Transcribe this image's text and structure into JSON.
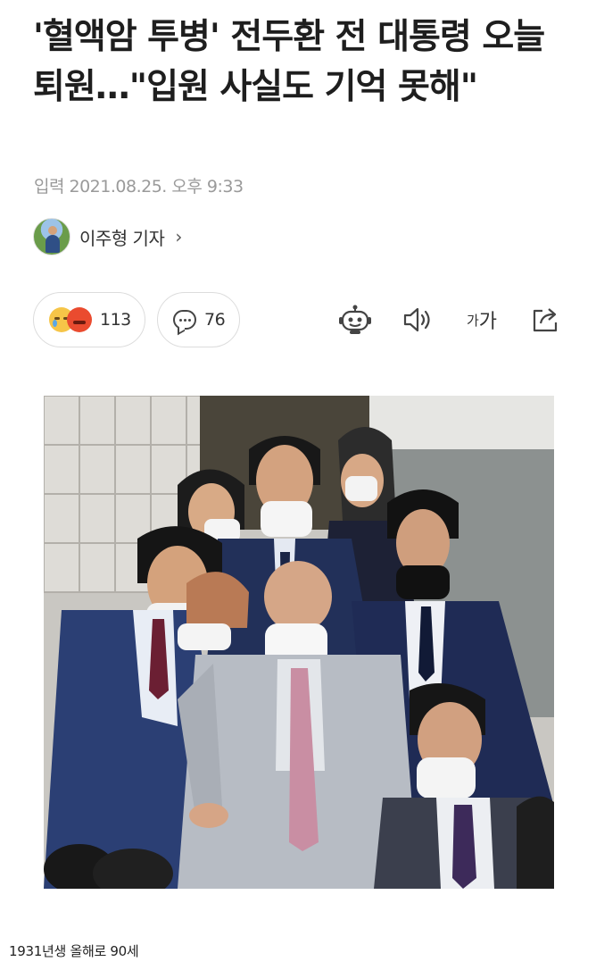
{
  "article": {
    "headline": "'혈액암 투병' 전두환 전 대통령 오늘 퇴원…\"입원 사실도 기억 못해\"",
    "dateline": "입력 2021.08.25. 오후 9:33",
    "reporter": {
      "name": "이주형 기자",
      "chevron": "›"
    }
  },
  "toolbar": {
    "reactions": {
      "count": "113",
      "icons": [
        "sad-face-icon",
        "angry-face-icon"
      ]
    },
    "comments": {
      "count": "76",
      "icon": "comment-icon"
    },
    "actions": [
      {
        "name": "summary-bot-icon"
      },
      {
        "name": "tts-speaker-icon"
      },
      {
        "name": "font-size",
        "small": "가",
        "big": "가"
      },
      {
        "name": "share-icon"
      }
    ]
  },
  "photo": {
    "description_alt": ""
  },
  "caption": "1931년생 올해로 90세",
  "colors": {
    "text": "#1e1e1e",
    "muted": "#9a9a9a",
    "border": "#dcdcdc"
  }
}
